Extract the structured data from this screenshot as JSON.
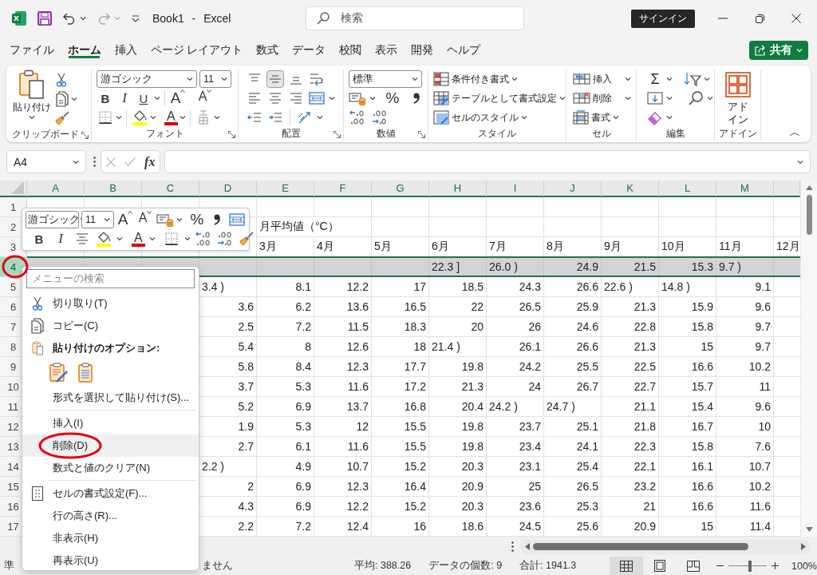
{
  "title_bar": {
    "title": "Book1 - Excel",
    "search_placeholder": "検索",
    "sign_in": "サインイン"
  },
  "menu_tabs": [
    {
      "label": "ファイル",
      "selected": false
    },
    {
      "label": "ホーム",
      "selected": true
    },
    {
      "label": "挿入",
      "selected": false
    },
    {
      "label": "ページ レイアウト",
      "selected": false
    },
    {
      "label": "数式",
      "selected": false
    },
    {
      "label": "データ",
      "selected": false
    },
    {
      "label": "校閲",
      "selected": false
    },
    {
      "label": "表示",
      "selected": false
    },
    {
      "label": "開発",
      "selected": false
    },
    {
      "label": "ヘルプ",
      "selected": false
    }
  ],
  "share_button": "共有",
  "ribbon": {
    "clipboard": {
      "label": "クリップボード",
      "paste": "貼り付け"
    },
    "font": {
      "label": "フォント",
      "font_name": "游ゴシック",
      "font_size": "11",
      "bold": "B",
      "italic": "I",
      "underline": "U",
      "grow": "A",
      "shrink": "A",
      "font_color": "A"
    },
    "alignment": {
      "label": "配置",
      "vertical_buttons": [
        {
          "kind": "top",
          "selected": false
        },
        {
          "kind": "middle",
          "selected": true
        },
        {
          "kind": "bottom",
          "selected": false
        }
      ]
    },
    "number": {
      "label": "数値",
      "format": "標準",
      "percent": "%"
    },
    "styles": {
      "label": "スタイル",
      "buttons": [
        "条件付き書式",
        "テーブルとして書式設定",
        "セルのスタイル"
      ]
    },
    "cells": {
      "label": "セル",
      "buttons": [
        "挿入",
        "削除",
        "書式"
      ]
    },
    "editing": {
      "label": "編集",
      "sum": "Σ"
    },
    "add_ins": {
      "label": "アドイン",
      "button": "アドイン"
    }
  },
  "formula_bar": {
    "name_box": "A4",
    "function_button": "fx"
  },
  "grid": {
    "columns": [
      "A",
      "B",
      "C",
      "D",
      "E",
      "F",
      "G",
      "H",
      "I",
      "J",
      "K",
      "L",
      "M"
    ],
    "rows": [
      {
        "header": "1",
        "selected": false,
        "circled": false,
        "cells": [
          null,
          null,
          null,
          null,
          null,
          null,
          null,
          null,
          null,
          null,
          null,
          null,
          null,
          null
        ]
      },
      {
        "header": "2",
        "selected": false,
        "circled": false,
        "cells": [
          null,
          null,
          null,
          null,
          {
            "text": "月平均値（°C）",
            "kind": "text"
          },
          null,
          null,
          null,
          null,
          null,
          null,
          null,
          null,
          null
        ]
      },
      {
        "header": "3",
        "selected": false,
        "circled": false,
        "cells": [
          null,
          null,
          null,
          null,
          {
            "text": "3月",
            "kind": "text"
          },
          {
            "text": "4月",
            "kind": "text"
          },
          {
            "text": "5月",
            "kind": "text"
          },
          {
            "text": "6月",
            "kind": "text"
          },
          {
            "text": "7月",
            "kind": "text"
          },
          {
            "text": "8月",
            "kind": "text"
          },
          {
            "text": "9月",
            "kind": "text"
          },
          {
            "text": "10月",
            "kind": "text"
          },
          {
            "text": "11月",
            "kind": "text"
          },
          {
            "text": "12月",
            "kind": "text"
          }
        ]
      },
      {
        "header": "4",
        "selected": true,
        "circled": true,
        "cells": [
          null,
          null,
          null,
          null,
          null,
          null,
          null,
          {
            "text": "22.3 ]",
            "kind": "text"
          },
          {
            "text": "26.0 )",
            "kind": "text"
          },
          {
            "text": "24.9",
            "kind": "number"
          },
          {
            "text": "21.5",
            "kind": "number"
          },
          {
            "text": "15.3",
            "kind": "number"
          },
          {
            "text": "9.7 )",
            "kind": "text"
          },
          null
        ]
      },
      {
        "header": "5",
        "selected": false,
        "circled": false,
        "cells": [
          null,
          null,
          null,
          {
            "text": "3.4 )",
            "kind": "text"
          },
          {
            "text": "8.1",
            "kind": "number"
          },
          {
            "text": "12.2",
            "kind": "number"
          },
          {
            "text": "17",
            "kind": "number"
          },
          {
            "text": "18.5",
            "kind": "number"
          },
          {
            "text": "24.3",
            "kind": "number"
          },
          {
            "text": "26.6",
            "kind": "number"
          },
          {
            "text": "22.6 )",
            "kind": "text"
          },
          {
            "text": "14.8 )",
            "kind": "text"
          },
          {
            "text": "9.1",
            "kind": "number"
          },
          null
        ]
      },
      {
        "header": "6",
        "selected": false,
        "circled": false,
        "cells": [
          null,
          null,
          null,
          {
            "text": "3.6",
            "kind": "number"
          },
          {
            "text": "6.2",
            "kind": "number"
          },
          {
            "text": "13.6",
            "kind": "number"
          },
          {
            "text": "16.5",
            "kind": "number"
          },
          {
            "text": "22",
            "kind": "number"
          },
          {
            "text": "26.5",
            "kind": "number"
          },
          {
            "text": "25.9",
            "kind": "number"
          },
          {
            "text": "21.3",
            "kind": "number"
          },
          {
            "text": "15.9",
            "kind": "number"
          },
          {
            "text": "9.6",
            "kind": "number"
          },
          null
        ]
      },
      {
        "header": "7",
        "selected": false,
        "circled": false,
        "cells": [
          null,
          null,
          null,
          {
            "text": "2.5",
            "kind": "number"
          },
          {
            "text": "7.2",
            "kind": "number"
          },
          {
            "text": "11.5",
            "kind": "number"
          },
          {
            "text": "18.3",
            "kind": "number"
          },
          {
            "text": "20",
            "kind": "number"
          },
          {
            "text": "26",
            "kind": "number"
          },
          {
            "text": "24.6",
            "kind": "number"
          },
          {
            "text": "22.8",
            "kind": "number"
          },
          {
            "text": "15.8",
            "kind": "number"
          },
          {
            "text": "9.7",
            "kind": "number"
          },
          null
        ]
      },
      {
        "header": "8",
        "selected": false,
        "circled": false,
        "cells": [
          null,
          null,
          null,
          {
            "text": "5.4",
            "kind": "number"
          },
          {
            "text": "8",
            "kind": "number"
          },
          {
            "text": "12.6",
            "kind": "number"
          },
          {
            "text": "18",
            "kind": "number"
          },
          {
            "text": "21.4 )",
            "kind": "text"
          },
          {
            "text": "26.1",
            "kind": "number"
          },
          {
            "text": "26.6",
            "kind": "number"
          },
          {
            "text": "21.3",
            "kind": "number"
          },
          {
            "text": "15",
            "kind": "number"
          },
          {
            "text": "9.7",
            "kind": "number"
          },
          null
        ]
      },
      {
        "header": "9",
        "selected": false,
        "circled": false,
        "cells": [
          null,
          null,
          null,
          {
            "text": "5.8",
            "kind": "number"
          },
          {
            "text": "8.4",
            "kind": "number"
          },
          {
            "text": "12.3",
            "kind": "number"
          },
          {
            "text": "17.7",
            "kind": "number"
          },
          {
            "text": "19.8",
            "kind": "number"
          },
          {
            "text": "24.2",
            "kind": "number"
          },
          {
            "text": "25.5",
            "kind": "number"
          },
          {
            "text": "22.5",
            "kind": "number"
          },
          {
            "text": "16.6",
            "kind": "number"
          },
          {
            "text": "10.2",
            "kind": "number"
          },
          null
        ]
      },
      {
        "header": "10",
        "selected": false,
        "circled": false,
        "cells": [
          null,
          null,
          null,
          {
            "text": "3.7",
            "kind": "number"
          },
          {
            "text": "5.3",
            "kind": "number"
          },
          {
            "text": "11.6",
            "kind": "number"
          },
          {
            "text": "17.2",
            "kind": "number"
          },
          {
            "text": "21.3",
            "kind": "number"
          },
          {
            "text": "24",
            "kind": "number"
          },
          {
            "text": "26.7",
            "kind": "number"
          },
          {
            "text": "22.7",
            "kind": "number"
          },
          {
            "text": "15.7",
            "kind": "number"
          },
          {
            "text": "11",
            "kind": "number"
          },
          null
        ]
      },
      {
        "header": "11",
        "selected": false,
        "circled": false,
        "cells": [
          null,
          null,
          null,
          {
            "text": "5.2",
            "kind": "number"
          },
          {
            "text": "6.9",
            "kind": "number"
          },
          {
            "text": "13.7",
            "kind": "number"
          },
          {
            "text": "16.8",
            "kind": "number"
          },
          {
            "text": "20.4",
            "kind": "number"
          },
          {
            "text": "24.2 )",
            "kind": "text"
          },
          {
            "text": "24.7 )",
            "kind": "text"
          },
          {
            "text": "21.1",
            "kind": "number"
          },
          {
            "text": "15.4",
            "kind": "number"
          },
          {
            "text": "9.6",
            "kind": "number"
          },
          null
        ]
      },
      {
        "header": "12",
        "selected": false,
        "circled": false,
        "cells": [
          null,
          null,
          null,
          {
            "text": "1.9",
            "kind": "number"
          },
          {
            "text": "5.3",
            "kind": "number"
          },
          {
            "text": "12",
            "kind": "number"
          },
          {
            "text": "15.5",
            "kind": "number"
          },
          {
            "text": "19.8",
            "kind": "number"
          },
          {
            "text": "23.7",
            "kind": "number"
          },
          {
            "text": "25.1",
            "kind": "number"
          },
          {
            "text": "21.8",
            "kind": "number"
          },
          {
            "text": "16.7",
            "kind": "number"
          },
          {
            "text": "10",
            "kind": "number"
          },
          null
        ]
      },
      {
        "header": "13",
        "selected": false,
        "circled": false,
        "cells": [
          null,
          null,
          null,
          {
            "text": "2.7",
            "kind": "number"
          },
          {
            "text": "6.1",
            "kind": "number"
          },
          {
            "text": "11.6",
            "kind": "number"
          },
          {
            "text": "15.5",
            "kind": "number"
          },
          {
            "text": "19.8",
            "kind": "number"
          },
          {
            "text": "23.4",
            "kind": "number"
          },
          {
            "text": "24.1",
            "kind": "number"
          },
          {
            "text": "22.3",
            "kind": "number"
          },
          {
            "text": "15.8",
            "kind": "number"
          },
          {
            "text": "7.6",
            "kind": "number"
          },
          null
        ]
      },
      {
        "header": "14",
        "selected": false,
        "circled": false,
        "cells": [
          null,
          null,
          null,
          {
            "text": "2.2 )",
            "kind": "text"
          },
          {
            "text": "4.9",
            "kind": "number"
          },
          {
            "text": "10.7",
            "kind": "number"
          },
          {
            "text": "15.2",
            "kind": "number"
          },
          {
            "text": "20.3",
            "kind": "number"
          },
          {
            "text": "23.1",
            "kind": "number"
          },
          {
            "text": "25.4",
            "kind": "number"
          },
          {
            "text": "22.1",
            "kind": "number"
          },
          {
            "text": "16.1",
            "kind": "number"
          },
          {
            "text": "10.7",
            "kind": "number"
          },
          null
        ]
      },
      {
        "header": "15",
        "selected": false,
        "circled": false,
        "cells": [
          null,
          null,
          null,
          {
            "text": "2",
            "kind": "number"
          },
          {
            "text": "6.9",
            "kind": "number"
          },
          {
            "text": "12.3",
            "kind": "number"
          },
          {
            "text": "16.4",
            "kind": "number"
          },
          {
            "text": "20.9",
            "kind": "number"
          },
          {
            "text": "25",
            "kind": "number"
          },
          {
            "text": "26.5",
            "kind": "number"
          },
          {
            "text": "23.2",
            "kind": "number"
          },
          {
            "text": "16.6",
            "kind": "number"
          },
          {
            "text": "10.2",
            "kind": "number"
          },
          null
        ]
      },
      {
        "header": "16",
        "selected": false,
        "circled": false,
        "cells": [
          null,
          null,
          null,
          {
            "text": "4.3",
            "kind": "number"
          },
          {
            "text": "6.9",
            "kind": "number"
          },
          {
            "text": "12.2",
            "kind": "number"
          },
          {
            "text": "15.2",
            "kind": "number"
          },
          {
            "text": "20.3",
            "kind": "number"
          },
          {
            "text": "23.6",
            "kind": "number"
          },
          {
            "text": "25.3",
            "kind": "number"
          },
          {
            "text": "21",
            "kind": "number"
          },
          {
            "text": "16.6",
            "kind": "number"
          },
          {
            "text": "11.6",
            "kind": "number"
          },
          null
        ]
      },
      {
        "header": "17",
        "selected": false,
        "circled": false,
        "cells": [
          null,
          null,
          null,
          {
            "text": "2.2",
            "kind": "number"
          },
          {
            "text": "7.2",
            "kind": "number"
          },
          {
            "text": "12.4",
            "kind": "number"
          },
          {
            "text": "16",
            "kind": "number"
          },
          {
            "text": "18.6",
            "kind": "number"
          },
          {
            "text": "24.5",
            "kind": "number"
          },
          {
            "text": "25.6",
            "kind": "number"
          },
          {
            "text": "20.9",
            "kind": "number"
          },
          {
            "text": "15",
            "kind": "number"
          },
          {
            "text": "11.4",
            "kind": "number"
          },
          null
        ]
      }
    ]
  },
  "mini_toolbar": {
    "font_name": "游ゴシック",
    "font_size": "11",
    "grow": "A",
    "shrink": "A",
    "percent": "%",
    "bold": "B",
    "italic": "I",
    "font_color": "A"
  },
  "context_menu": {
    "search_placeholder": "メニューの検索",
    "sections": [
      [
        {
          "kind": "cut",
          "label": "切り取り(T)",
          "highlighted": false,
          "circled": false
        },
        {
          "kind": "copy",
          "label": "コピー(C)",
          "highlighted": false,
          "circled": false
        },
        {
          "kind": "paste_heading",
          "label": "貼り付けのオプション:",
          "highlighted": false,
          "circled": false
        },
        {
          "kind": "paste_options",
          "highlighted": false,
          "circled": false
        },
        {
          "kind": "plain",
          "label": "形式を選択して貼り付け(S)...",
          "highlighted": false,
          "circled": false
        }
      ],
      [
        {
          "kind": "plain",
          "label": "挿入(I)",
          "highlighted": false,
          "circled": false
        },
        {
          "kind": "plain",
          "label": "削除(D)",
          "highlighted": true,
          "circled": true
        },
        {
          "kind": "plain",
          "label": "数式と値のクリア(N)",
          "highlighted": false,
          "circled": false
        }
      ],
      [
        {
          "kind": "format_cells",
          "label": "セルの書式設定(F)...",
          "highlighted": false,
          "circled": false
        },
        {
          "kind": "plain",
          "label": "行の高さ(R)...",
          "highlighted": false,
          "circled": false
        },
        {
          "kind": "plain",
          "label": "非表示(H)",
          "highlighted": false,
          "circled": false
        },
        {
          "kind": "plain",
          "label": "再表示(U)",
          "highlighted": false,
          "circled": false
        }
      ]
    ]
  },
  "status_bar": {
    "left": [
      "準",
      "ません"
    ],
    "stats": [
      "平均: 388.26",
      "データの個数: 9",
      "合計: 1941.3"
    ],
    "views": [
      {
        "kind": "normal",
        "selected": true
      },
      {
        "kind": "page_layout",
        "selected": false
      },
      {
        "kind": "page_break",
        "selected": false
      }
    ],
    "zoom": {
      "level": 0.55,
      "reading": "100%"
    }
  }
}
